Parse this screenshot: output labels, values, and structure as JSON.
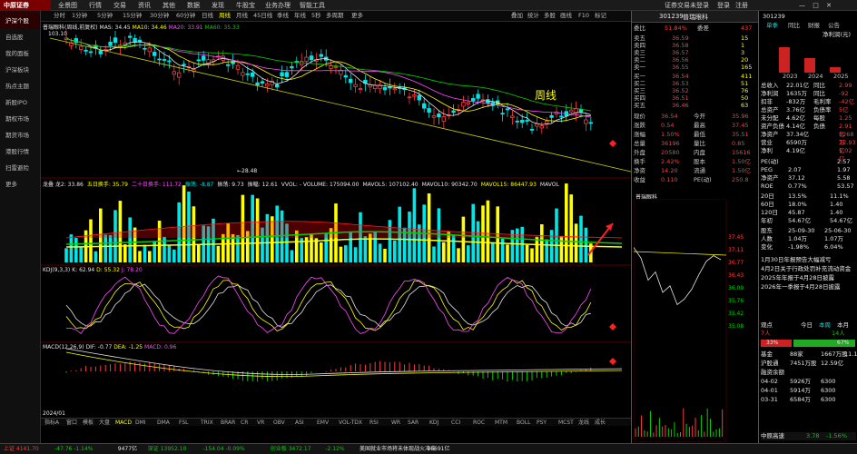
{
  "app": {
    "logo": "中原证券",
    "menu": [
      "全景图",
      "行情",
      "交易",
      "资讯",
      "其他",
      "数据",
      "发现",
      "牛股宝",
      "业务办理",
      "智能工具"
    ],
    "right_top": [
      "证券交易未登录",
      "登录",
      "注册"
    ]
  },
  "sidebar": {
    "items": [
      "沪深个股",
      "自选股",
      "我的面板",
      "沪深板块",
      "热点主题",
      "新股IPO",
      "期权市场",
      "期货市场",
      "港股行情",
      "扫雷避险",
      "更多"
    ],
    "active_index": 0
  },
  "periods": [
    "分时",
    "1分钟",
    "5分钟",
    "15分钟",
    "30分钟",
    "60分钟",
    "日线",
    "周线",
    "月线",
    "45日线",
    "季线",
    "年线",
    "5秒",
    "多周期",
    "更多"
  ],
  "period_active": "周线",
  "chart_tools": [
    "叠加",
    "统计",
    "多股",
    "画线",
    "F10",
    "标记"
  ],
  "chart_overlay_label": "周线",
  "main_legend": {
    "title": "普瑞眼科(周线,前复权)",
    "ma_label": "MAS: 34.45",
    "ma10": "MA10: 34.46",
    "ma20": "MA20: 33.91",
    "ma60": "MA60: 35.33",
    "high_label": "103.10",
    "low_label": "28.48"
  },
  "vol_legend": {
    "items": [
      {
        "text": "龙叠 龙2: 33.86",
        "color": "#e6e6e6"
      },
      {
        "text": "五日换手: 35.79",
        "color": "#ffff00"
      },
      {
        "text": "二十日换手: 111.72",
        "color": "#ff4cff"
      },
      {
        "text": "振荡: -8.87",
        "color": "#00e5e5"
      },
      {
        "text": "振荡: 9.73",
        "color": "#e6e6e6"
      },
      {
        "text": "振幅: 12.61",
        "color": "#e6e6e6"
      },
      {
        "text": "VVOL: - VOLUME: 175094.00",
        "color": "#e6e6e6"
      },
      {
        "text": "MAVOL5: 107102.40",
        "color": "#e6e6e6"
      },
      {
        "text": "MAVOL10: 90342.70",
        "color": "#e6e6e6"
      },
      {
        "text": "MAVOL15: 86447.93",
        "color": "#ffff00"
      },
      {
        "text": "MAVOL",
        "color": "#e6e6e6"
      }
    ]
  },
  "kdj_legend": {
    "title": "KDJ(9,3,3)",
    "k": "K: 62.94",
    "d": "D: 55.32",
    "j": "J: 78.20"
  },
  "macd_legend": {
    "title": "MACD(12,26,9)",
    "dif": "DIF: -0.77",
    "dea": "DEA: -1.25",
    "macd": "MACD: 0.96"
  },
  "date_label": "2024/01",
  "indicator_tabs": [
    "指标A",
    "窗口",
    "模板",
    "大盘",
    "MACD",
    "DMI",
    "DMA",
    "FSL",
    "TRIX",
    "BRAR",
    "CR",
    "VR",
    "OBV",
    "ASI",
    "EMV",
    "VOL-TDX",
    "RSI",
    "WR",
    "SAR",
    "KDJ",
    "CCI",
    "ROC",
    "MTM",
    "BOLL",
    "PSY",
    "MCST",
    "龙线",
    "成长"
  ],
  "indicator_tabs_active": "MACD",
  "quote": {
    "code": "301239",
    "name": "普瑞眼科",
    "weibi_label": "委比",
    "weibi": "51.84%",
    "weicha_label": "委差",
    "weicha": "437",
    "asks": [
      {
        "label": "卖五",
        "price": "36.59",
        "vol": "15"
      },
      {
        "label": "卖四",
        "price": "36.58",
        "vol": "1"
      },
      {
        "label": "卖三",
        "price": "36.57",
        "vol": "3"
      },
      {
        "label": "卖二",
        "price": "36.56",
        "vol": "20"
      },
      {
        "label": "卖一",
        "price": "36.55",
        "vol": "165"
      }
    ],
    "bids": [
      {
        "label": "买一",
        "price": "36.54",
        "vol": "411"
      },
      {
        "label": "买二",
        "price": "36.53",
        "vol": "51"
      },
      {
        "label": "买三",
        "price": "36.52",
        "vol": "76"
      },
      {
        "label": "买四",
        "price": "36.51",
        "vol": "50"
      },
      {
        "label": "买五",
        "price": "36.46",
        "vol": "63"
      }
    ],
    "stats": [
      {
        "l1": "现价",
        "v1": "36.54",
        "l2": "今开",
        "v2": "35.96"
      },
      {
        "l1": "涨跌",
        "v1": "0.54",
        "l2": "最高",
        "v2": "37.45"
      },
      {
        "l1": "涨幅",
        "v1": "1.50%",
        "l2": "最低",
        "v2": "35.51"
      },
      {
        "l1": "总量",
        "v1": "36196",
        "l2": "量比",
        "v2": "0.85"
      },
      {
        "l1": "外盘",
        "v1": "20580",
        "l2": "内盘",
        "v2": "15616"
      },
      {
        "l1": "换手",
        "v1": "2.42%",
        "l2": "股本",
        "v2": "1.50亿"
      },
      {
        "l1": "净资",
        "v1": "14.20",
        "l2": "流通",
        "v2": "1.50亿"
      },
      {
        "l1": "收益",
        "v1": "0.110",
        "l2": "PE(动)",
        "v2": "250.8"
      }
    ],
    "intraday_title": "普瑞眼科",
    "intraday_axis": [
      "37.45",
      "37.11",
      "36.77",
      "36.43",
      "36.09",
      "35.76",
      "35.42",
      "35.08"
    ]
  },
  "far_right": {
    "code": "301239",
    "nav": [
      "单季",
      "同比",
      "财报",
      "公告"
    ],
    "profit_label": "净利润(元)",
    "years": [
      "2023",
      "2024",
      "2025"
    ],
    "fin": [
      {
        "l": "总收入",
        "v": "22.01亿",
        "l2": "同比",
        "v2": "2.99"
      },
      {
        "l": "净利润",
        "v": "1635万",
        "l2": "同比",
        "v2": "-92"
      },
      {
        "l": "扣非",
        "v": "-832万",
        "l2": "毛利率",
        "v2": "-42亿"
      },
      {
        "l": "总资产",
        "v": "3.76亿",
        "l2": "负债率",
        "v2": "5亿"
      },
      {
        "l": "未分配",
        "v": "4.62亿",
        "l2": "每股",
        "v2": "1.25"
      },
      {
        "l": "资产负债",
        "v": "4.14亿",
        "l2": "负债",
        "v2": "2.91亿"
      },
      {
        "l": "净资产",
        "v": "37.34亿",
        "l2": "",
        "v2": "3268万"
      },
      {
        "l": "营业",
        "v": "6590万",
        "l2": "",
        "v2": "12.93亿"
      },
      {
        "l": "净利",
        "v": "4.19亿",
        "l2": "",
        "v2": "1.02亿"
      }
    ],
    "pe_rows": [
      {
        "l": "PE(动)",
        "v": "",
        "v2": "2.57"
      },
      {
        "l": "PEG",
        "v": "2.07",
        "v2": "1.97"
      },
      {
        "l": "净资产",
        "v": "37.12",
        "v2": "5.58"
      },
      {
        "l": "ROE",
        "v": "0.77%",
        "v2": "53.57"
      }
    ],
    "perf_rows": [
      {
        "l": "20日",
        "v": "13.5%",
        "v2": "11.1%"
      },
      {
        "l": "60日",
        "v": "18.0%",
        "v2": "1.40"
      },
      {
        "l": "120日",
        "v": "45.87",
        "v2": "1.40"
      },
      {
        "l": "年初",
        "v": "54.67亿",
        "v2": "54.67亿"
      }
    ],
    "dates": [
      {
        "l": "股东",
        "v": "25-09-30",
        "v2": "25-06-30"
      },
      {
        "l": "人数",
        "v": "1.04万",
        "v2": "1.07万"
      },
      {
        "l": "变化",
        "v": "-1.98%",
        "v2": "6.04%"
      }
    ],
    "news": [
      "1月30日年报预告大幅减亏",
      "4月2日关于行政处罚补充流动资金",
      "2025年年报于4月28日披露",
      "2026年一季报于4月28日披露"
    ],
    "sentiment": {
      "label": "观点",
      "today": "今日",
      "view": "本周",
      "month": "本月",
      "up": "33%",
      "down": "67%",
      "people_up": "7人",
      "people_down": "14人"
    },
    "holdings": [
      {
        "l": "基金",
        "v": "88家",
        "v2": "1667万股",
        "v3": "11.1%"
      },
      {
        "l": "沪股通",
        "v": "7451万股",
        "v2": "12.59亿",
        "v3": ""
      },
      {
        "l": "融资余额",
        "v": "",
        "v2": "",
        "v3": ""
      },
      {
        "l": "04-02",
        "v": "5926万",
        "v2": "6300",
        "v3": ""
      },
      {
        "l": "04-01",
        "v": "5914万",
        "v2": "6300",
        "v3": ""
      },
      {
        "l": "03-31",
        "v": "6584万",
        "v2": "6300",
        "v3": ""
      }
    ],
    "bottom": {
      "label": "中原高速",
      "price": "3.78",
      "change": "-1.56%"
    }
  },
  "status": {
    "items": [
      {
        "t": "上证 4141.70",
        "c": "#ff3c3c"
      },
      {
        "t": "-47.76 -1.14%",
        "c": "#00d000"
      },
      {
        "t": "9477亿",
        "c": "#e6e6e6"
      },
      {
        "t": "深证 13952.10",
        "c": "#00d000"
      },
      {
        "t": "-154.04 -0.09%",
        "c": "#00d000"
      },
      {
        "t": "创业板 3472.17",
        "c": "#00d000"
      },
      {
        "t": "-2.12%",
        "c": "#00d000"
      },
      {
        "t": "美国就业市场将未体现战火冲击",
        "c": "#e6e6e6"
      },
      {
        "t": "16691亿",
        "c": "#e6e6e6"
      }
    ]
  }
}
